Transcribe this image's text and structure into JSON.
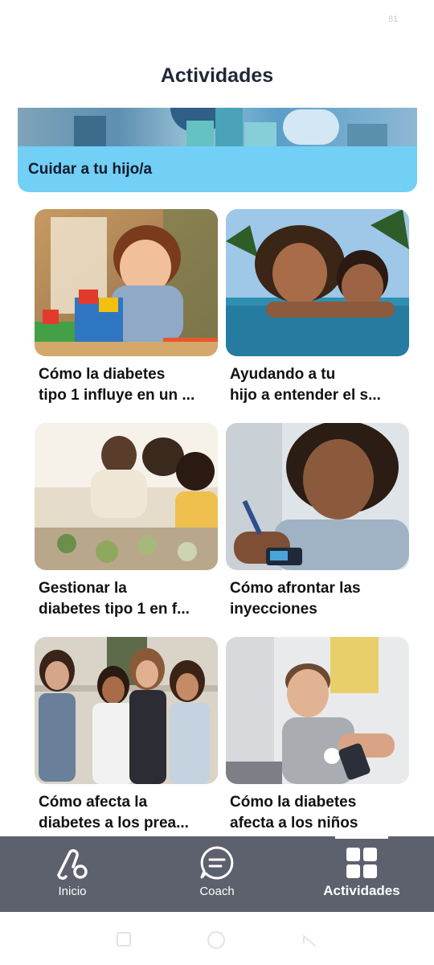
{
  "status_bar": {
    "battery": "81"
  },
  "header": {
    "title": "Actividades"
  },
  "banner": {
    "label": "Cuidar a tu hijo/a"
  },
  "cards": [
    {
      "title": "Cómo la diabetes\ntipo 1 influye en un ..."
    },
    {
      "title": "Ayudando a tu\nhijo a entender el s..."
    },
    {
      "title": "Gestionar la\ndiabetes tipo 1 en f..."
    },
    {
      "title": "Cómo afrontar las\ninyecciones"
    },
    {
      "title": "Cómo afecta la\ndiabetes a los prea..."
    },
    {
      "title": "Cómo la diabetes\nafecta a los niños"
    }
  ],
  "bottom_nav": {
    "items": [
      {
        "label": "Inicio",
        "icon": "loop-icon"
      },
      {
        "label": "Coach",
        "icon": "chat-icon"
      },
      {
        "label": "Actividades",
        "icon": "grid-icon",
        "active": true
      }
    ]
  },
  "colors": {
    "banner_bg": "#72cff6",
    "nav_bg": "#5d606d",
    "title": "#1f2937"
  }
}
